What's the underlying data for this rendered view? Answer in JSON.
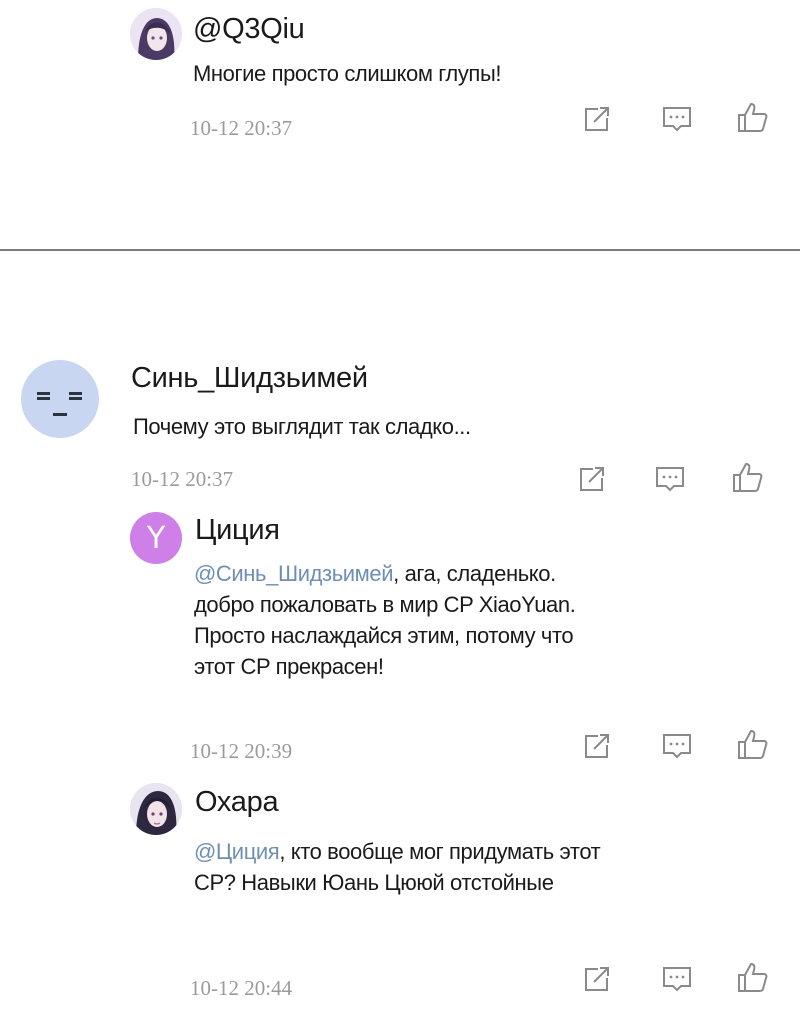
{
  "comments": [
    {
      "username": "@Q3Qiu",
      "text": "Многие просто слишком глупы!",
      "timestamp": "10-12  20:37",
      "avatar_icon": "anime-girl-avatar"
    },
    {
      "username": "Синь_Шидзьимей",
      "text": "Почему это выглядит так сладко...",
      "timestamp": "10-12  20:37",
      "avatar_icon": "sleepy-face-avatar"
    },
    {
      "username": "Циция",
      "mention": "@Синь_Шидзьимей",
      "text_after_mention": ", ага, сладенько.",
      "text_lines": [
        "добро пожаловать в мир CP XiaoYuan.",
        "Просто наслаждайся этим, потому что",
        "этот CP прекрасен!"
      ],
      "timestamp": "10-12  20:39",
      "avatar_letter": "Y"
    },
    {
      "username": "Охара",
      "mention": "@Циция",
      "text_after_mention": ", кто вообще мог придумать этот",
      "text_lines": [
        "CP? Навыки Юань Цююй отстойные"
      ],
      "timestamp": "10-12  20:44",
      "avatar_icon": "anime-character-avatar"
    }
  ],
  "actions": {
    "share_icon": "share-icon",
    "reply_icon": "reply-comment-icon",
    "like_icon": "thumbs-up-icon"
  },
  "colors": {
    "mention": "#6e8fb3",
    "timestamp": "#9b9b9b",
    "divider": "#7a7a7a",
    "letter_avatar": "#cf7fe8",
    "face_avatar": "#c9d6f2"
  }
}
